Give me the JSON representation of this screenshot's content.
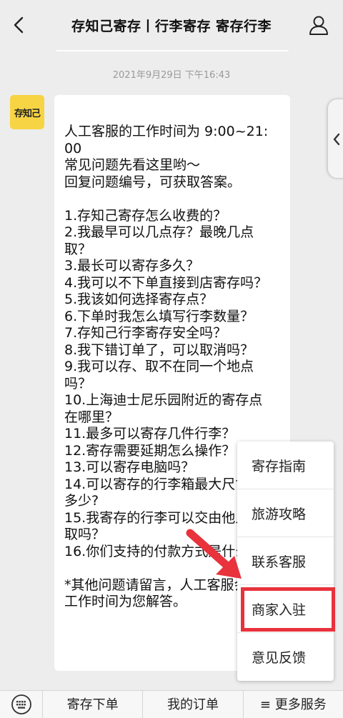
{
  "header": {
    "title": "存知己寄存丨行李寄存 寄存行李"
  },
  "chat": {
    "timestamp": "2021年9月29日 下午16:43",
    "avatar_text": "存知己",
    "message_lines": [
      "人工客服的工作时间为 9:00~21:",
      "00",
      "常见问题先看这里哟～",
      "回复问题编号，可获取答案。",
      "",
      "1.存知己寄存怎么收费的？",
      "2.我最早可以几点存？最晚几点",
      "取？",
      "3.最长可以寄存多久？",
      "4.我可以不下单直接到店寄存吗？",
      "5.我该如何选择寄存点？",
      "6.下单时我怎么填写行李数量？",
      "7.存知己行李寄存安全吗？",
      "8.我下错订单了，可以取消吗？",
      "9.我可以存、取不在同一个地点",
      "吗？",
      "10.上海迪士尼乐园附近的寄存点",
      "在哪里？",
      "11.最多可以寄存几件行李？",
      "12.寄存需要延期怎么操作？",
      "13.可以寄存电脑吗？",
      "14.可以寄存的行李箱最大尺寸是",
      "多少?",
      "15.我寄存的行李可以交由他人代",
      "取吗？",
      "16.你们支持的付款方式是什么？",
      "",
      "*其他问题请留言，人工客服会在",
      "工作时间为您解答。"
    ]
  },
  "menu": {
    "items": [
      "寄存指南",
      "旅游攻略",
      "联系客服",
      "商家入驻",
      "意见反馈"
    ],
    "highlighted_index": 3
  },
  "bottom_bar": {
    "tab1": "寄存下单",
    "tab2": "我的订单",
    "tab3": "≡ 更多服务"
  },
  "colors": {
    "background": "#ededed",
    "avatar": "#f7d443",
    "highlight": "#e8323c"
  },
  "icons": [
    "back-arrow-icon",
    "profile-icon",
    "chevron-left-icon",
    "keyboard-icon",
    "red-arrow-icon"
  ]
}
